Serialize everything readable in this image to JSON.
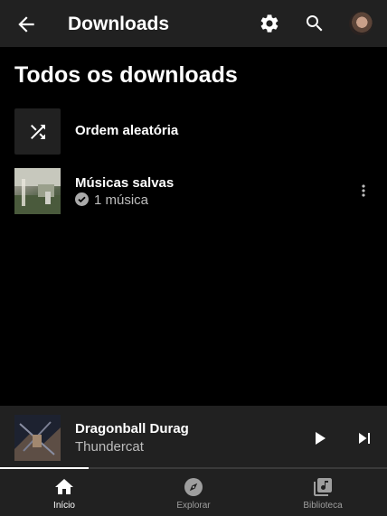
{
  "header": {
    "title": "Downloads",
    "back_icon": "arrow-left-icon",
    "settings_icon": "gear-icon",
    "search_icon": "search-icon"
  },
  "main": {
    "section_title": "Todos os downloads",
    "shuffle": {
      "label": "Ordem aleatória",
      "icon": "shuffle-icon"
    },
    "saved": {
      "label": "Músicas salvas",
      "subtitle": "1 música",
      "more_icon": "more-vert-icon"
    }
  },
  "player": {
    "title": "Dragonball Durag",
    "artist": "Thundercat",
    "progress": 0.23,
    "play_icon": "play-icon",
    "next_icon": "skip-next-icon"
  },
  "nav": {
    "items": [
      {
        "label": "Início",
        "icon": "home-icon",
        "active": true
      },
      {
        "label": "Explorar",
        "icon": "compass-icon",
        "active": false
      },
      {
        "label": "Biblioteca",
        "icon": "library-icon",
        "active": false
      }
    ]
  },
  "colors": {
    "background": "#000000",
    "surface": "#212121",
    "text_secondary": "#bdbdbd"
  }
}
